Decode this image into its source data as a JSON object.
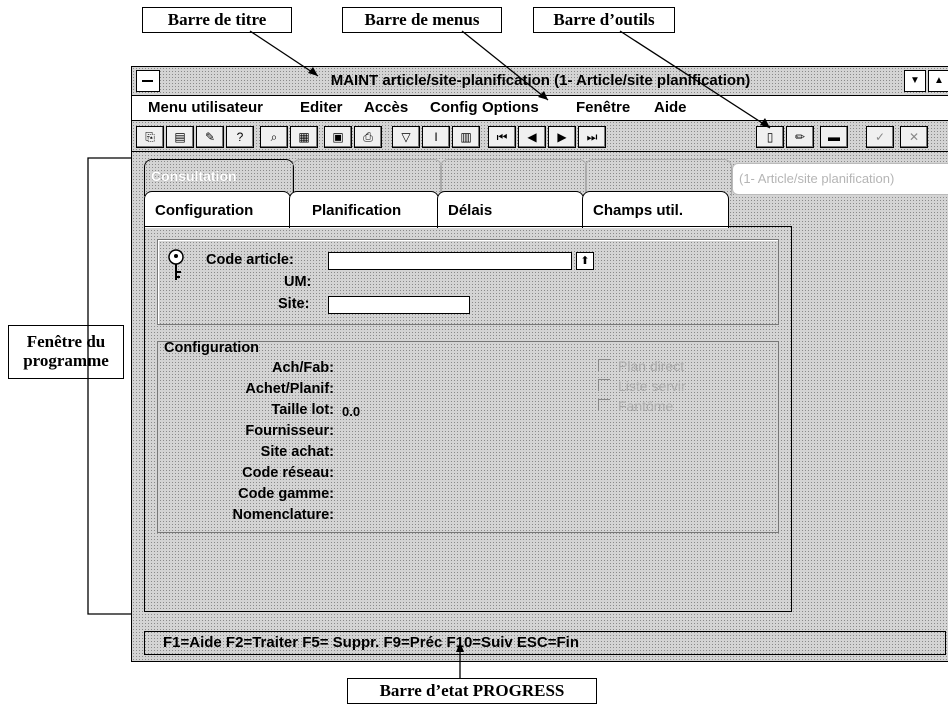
{
  "callouts": {
    "title_bar": "Barre de titre",
    "menu_bar": "Barre de menus",
    "toolbar": "Barre d’outils",
    "program_window": "Fenêtre du programme",
    "status_bar": "Barre d’etat PROGRESS"
  },
  "window": {
    "title": "MAINT article/site-planification (1- Article/site planification)",
    "menu": [
      "Menu utilisateur",
      "Editer",
      "Accès",
      "Config",
      "Options",
      "Fenêtre",
      "Aide"
    ],
    "toolbar_icons": [
      "copy-icon",
      "stack-icon",
      "tools-icon",
      "help-icon",
      "search-icon",
      "grid-icon",
      "calculator-icon",
      "print-icon",
      "filter-icon",
      "info-icon",
      "list-icon",
      "first-icon",
      "previous-icon",
      "next-icon",
      "last-icon",
      "new-icon",
      "edit-icon",
      "delete-icon",
      "check-icon",
      "close-icon"
    ]
  },
  "tabs": {
    "mode_tab": "Consultation",
    "context_label": "(1- Article/site planification)",
    "items": [
      "Configuration",
      "Planification",
      "Délais",
      "Champs util."
    ]
  },
  "form": {
    "code_article": {
      "label": "Code article:",
      "value": ""
    },
    "um": {
      "label": "UM:",
      "value": ""
    },
    "site": {
      "label": "Site:",
      "value": ""
    },
    "config_title": "Configuration",
    "fields": [
      {
        "label": "Ach/Fab:",
        "value": ""
      },
      {
        "label": "Achet/Planif:",
        "value": ""
      },
      {
        "label": "Taille lot:",
        "value": "0.0"
      },
      {
        "label": "Fournisseur:",
        "value": ""
      },
      {
        "label": "Site achat:",
        "value": ""
      },
      {
        "label": "Code réseau:",
        "value": ""
      },
      {
        "label": "Code gamme:",
        "value": ""
      },
      {
        "label": "Nomenclature:",
        "value": ""
      }
    ],
    "checkboxes": [
      "Plan direct",
      "Liste servir",
      "Fantôme"
    ]
  },
  "status": {
    "text": "F1=Aide  F2=Traiter  F5= Suppr.  F9=Préc  F10=Suiv  ESC=Fin"
  }
}
